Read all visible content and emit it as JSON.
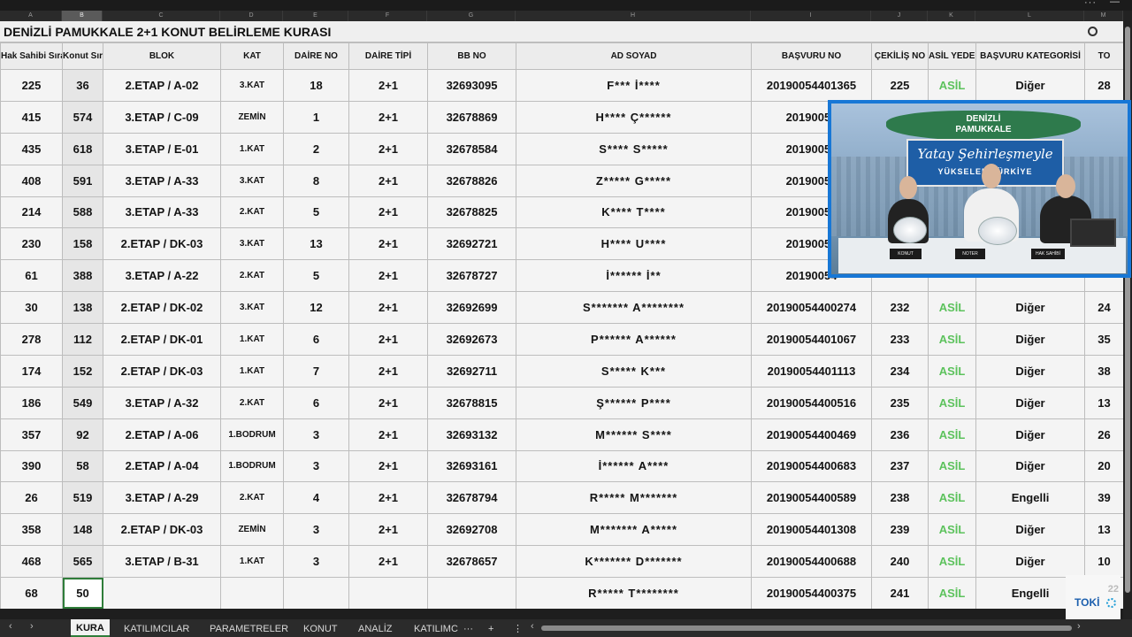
{
  "column_letters": [
    "A",
    "B",
    "C",
    "D",
    "E",
    "F",
    "G",
    "H",
    "I",
    "J",
    "K",
    "L",
    "M"
  ],
  "title": "DENİZLİ  PAMUKKALE 2+1 KONUT BELİRLEME KURASI",
  "headers": {
    "hak_sahibi": "Hak Sahibi Sıra No",
    "konut": "Konut Sıra No",
    "blok": "BLOK",
    "kat": "KAT",
    "daire_no": "DAİRE NO",
    "daire_tipi": "DAİRE TİPİ",
    "bb_no": "BB NO",
    "ad_soyad": "AD SOYAD",
    "basvuru_no": "BAŞVURU NO",
    "cekilis_no": "ÇEKİLİŞ NO",
    "asil_yedek": "ASİL YEDEK",
    "basvuru_kategorisi": "BAŞVURU KATEGORİSİ",
    "last": "TO"
  },
  "rows": [
    {
      "hak": "225",
      "konut": "36",
      "blok": "2.ETAP / A-02",
      "kat": "3.KAT",
      "daire": "18",
      "tip": "2+1",
      "bb": "32693095",
      "ad": "F*** İ****",
      "basvuru": "20190054401365",
      "cekilis": "225",
      "asil": "ASİL",
      "kategori": "Diğer",
      "to": "28"
    },
    {
      "hak": "415",
      "konut": "574",
      "blok": "3.ETAP / C-09",
      "kat": "ZEMİN",
      "daire": "1",
      "tip": "2+1",
      "bb": "32678869",
      "ad": "H**** Ç******",
      "basvuru": "20190054",
      "cekilis": "",
      "asil": "",
      "kategori": "",
      "to": ""
    },
    {
      "hak": "435",
      "konut": "618",
      "blok": "3.ETAP / E-01",
      "kat": "1.KAT",
      "daire": "2",
      "tip": "2+1",
      "bb": "32678584",
      "ad": "S**** S*****",
      "basvuru": "20190054",
      "cekilis": "",
      "asil": "",
      "kategori": "",
      "to": ""
    },
    {
      "hak": "408",
      "konut": "591",
      "blok": "3.ETAP / A-33",
      "kat": "3.KAT",
      "daire": "8",
      "tip": "2+1",
      "bb": "32678826",
      "ad": "Z***** G*****",
      "basvuru": "20190054",
      "cekilis": "",
      "asil": "",
      "kategori": "",
      "to": ""
    },
    {
      "hak": "214",
      "konut": "588",
      "blok": "3.ETAP / A-33",
      "kat": "2.KAT",
      "daire": "5",
      "tip": "2+1",
      "bb": "32678825",
      "ad": "K**** T****",
      "basvuru": "20190054",
      "cekilis": "",
      "asil": "",
      "kategori": "",
      "to": ""
    },
    {
      "hak": "230",
      "konut": "158",
      "blok": "2.ETAP / DK-03",
      "kat": "3.KAT",
      "daire": "13",
      "tip": "2+1",
      "bb": "32692721",
      "ad": "H**** U****",
      "basvuru": "20190054",
      "cekilis": "",
      "asil": "",
      "kategori": "",
      "to": ""
    },
    {
      "hak": "61",
      "konut": "388",
      "blok": "3.ETAP / A-22",
      "kat": "2.KAT",
      "daire": "5",
      "tip": "2+1",
      "bb": "32678727",
      "ad": "İ****** İ**",
      "basvuru": "20190054",
      "cekilis": "",
      "asil": "",
      "kategori": "",
      "to": ""
    },
    {
      "hak": "30",
      "konut": "138",
      "blok": "2.ETAP / DK-02",
      "kat": "3.KAT",
      "daire": "12",
      "tip": "2+1",
      "bb": "32692699",
      "ad": "S******* A********",
      "basvuru": "20190054400274",
      "cekilis": "232",
      "asil": "ASİL",
      "kategori": "Diğer",
      "to": "24"
    },
    {
      "hak": "278",
      "konut": "112",
      "blok": "2.ETAP / DK-01",
      "kat": "1.KAT",
      "daire": "6",
      "tip": "2+1",
      "bb": "32692673",
      "ad": "P****** A******",
      "basvuru": "20190054401067",
      "cekilis": "233",
      "asil": "ASİL",
      "kategori": "Diğer",
      "to": "35"
    },
    {
      "hak": "174",
      "konut": "152",
      "blok": "2.ETAP / DK-03",
      "kat": "1.KAT",
      "daire": "7",
      "tip": "2+1",
      "bb": "32692711",
      "ad": "S***** K***",
      "basvuru": "20190054401113",
      "cekilis": "234",
      "asil": "ASİL",
      "kategori": "Diğer",
      "to": "38"
    },
    {
      "hak": "186",
      "konut": "549",
      "blok": "3.ETAP / A-32",
      "kat": "2.KAT",
      "daire": "6",
      "tip": "2+1",
      "bb": "32678815",
      "ad": "Ş****** P****",
      "basvuru": "20190054400516",
      "cekilis": "235",
      "asil": "ASİL",
      "kategori": "Diğer",
      "to": "13"
    },
    {
      "hak": "357",
      "konut": "92",
      "blok": "2.ETAP / A-06",
      "kat": "1.BODRUM",
      "daire": "3",
      "tip": "2+1",
      "bb": "32693132",
      "ad": "M****** S****",
      "basvuru": "20190054400469",
      "cekilis": "236",
      "asil": "ASİL",
      "kategori": "Diğer",
      "to": "26"
    },
    {
      "hak": "390",
      "konut": "58",
      "blok": "2.ETAP / A-04",
      "kat": "1.BODRUM",
      "daire": "3",
      "tip": "2+1",
      "bb": "32693161",
      "ad": "İ****** A****",
      "basvuru": "20190054400683",
      "cekilis": "237",
      "asil": "ASİL",
      "kategori": "Diğer",
      "to": "20"
    },
    {
      "hak": "26",
      "konut": "519",
      "blok": "3.ETAP / A-29",
      "kat": "2.KAT",
      "daire": "4",
      "tip": "2+1",
      "bb": "32678794",
      "ad": "R***** M*******",
      "basvuru": "20190054400589",
      "cekilis": "238",
      "asil": "ASİL",
      "kategori": "Engelli",
      "to": "39"
    },
    {
      "hak": "358",
      "konut": "148",
      "blok": "2.ETAP / DK-03",
      "kat": "ZEMİN",
      "daire": "3",
      "tip": "2+1",
      "bb": "32692708",
      "ad": "M******* A*****",
      "basvuru": "20190054401308",
      "cekilis": "239",
      "asil": "ASİL",
      "kategori": "Diğer",
      "to": "13"
    },
    {
      "hak": "468",
      "konut": "565",
      "blok": "3.ETAP / B-31",
      "kat": "1.KAT",
      "daire": "3",
      "tip": "2+1",
      "bb": "32678657",
      "ad": "K******* D*******",
      "basvuru": "20190054400688",
      "cekilis": "240",
      "asil": "ASİL",
      "kategori": "Diğer",
      "to": "10"
    },
    {
      "hak": "68",
      "konut": "50",
      "blok": "",
      "kat": "",
      "daire": "",
      "tip": "",
      "bb": "",
      "ad": "R***** T********",
      "basvuru": "20190054400375",
      "cekilis": "241",
      "asil": "ASİL",
      "kategori": "Engelli",
      "to": ""
    }
  ],
  "tabs": [
    "KURA",
    "KATILIMCILAR",
    "PARAMETRELER",
    "KONUT",
    "ANALİZ",
    "KATILIMC"
  ],
  "tab_add": "+",
  "tab_more": "⋮",
  "tab_ellipsis": "···",
  "nav_prev": "‹",
  "nav_next": "›",
  "window_dots": "···",
  "window_dash": "—",
  "video": {
    "banner_line1": "DENİZLİ",
    "banner_line2": "PAMUKKALE",
    "slogan_line1": "Yatay Şehirleşmeyle",
    "slogan_line2": "YÜKSELEN TÜRKİYE",
    "sign_konut": "KONUT",
    "sign_noter": "NOTER",
    "sign_hak": "HAK SAHİBİ"
  },
  "toki": {
    "logo": "TOKİ",
    "num": "22"
  },
  "colors": {
    "asil": "#5cc25c",
    "accent_blue": "#1777d6",
    "active_green": "#2f7d3a"
  }
}
